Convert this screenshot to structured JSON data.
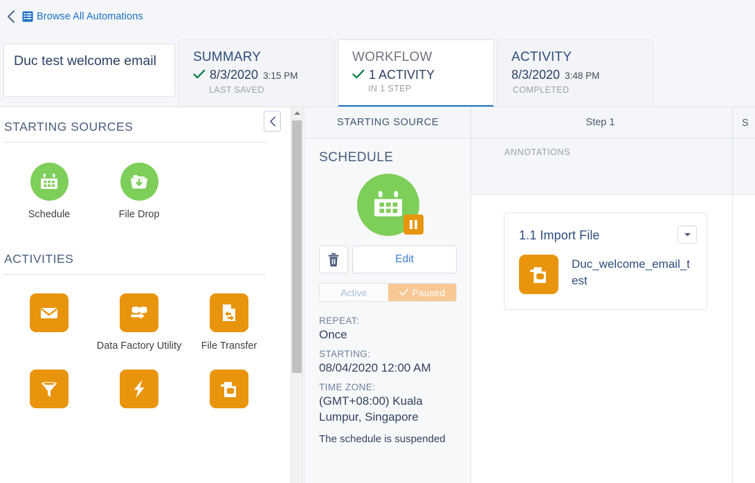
{
  "breadcrumb": {
    "back_icon": "chevron-left-icon",
    "list_icon": "list-table-icon",
    "link_label": "Browse All Automations"
  },
  "automation": {
    "name": "Duc test welcome email"
  },
  "tabs": [
    {
      "id": "summary",
      "title": "SUMMARY",
      "has_check": true,
      "date": "8/3/2020",
      "time": "3:15 PM",
      "subtitle": "LAST SAVED",
      "active": false,
      "title_color": "#2d4d7c"
    },
    {
      "id": "workflow",
      "title": "WORKFLOW",
      "has_check": true,
      "date": "1 ACTIVITY",
      "time": "",
      "subtitle": "IN 1 STEP",
      "active": true,
      "title_color": "#6d7580"
    },
    {
      "id": "activity",
      "title": "ACTIVITY",
      "has_check": false,
      "date": "8/3/2020",
      "time": "3:48 PM",
      "subtitle": "COMPLETED",
      "active": false,
      "title_color": "#2d4d7c"
    }
  ],
  "palette": {
    "starting_sources_heading": "STARTING SOURCES",
    "collapse_icon": "chevron-left-icon",
    "starting_sources": [
      {
        "label": "Schedule",
        "icon": "calendar-icon",
        "color": "#7ece5a"
      },
      {
        "label": "File Drop",
        "icon": "file-drop-icon",
        "color": "#7ece5a"
      }
    ],
    "activities_heading": "ACTIVITIES",
    "activities": [
      {
        "label": "",
        "icon": "envelope-icon",
        "color": "#e8940c"
      },
      {
        "label": "Data Factory Utility",
        "icon": "data-factory-icon",
        "color": "#e8940c"
      },
      {
        "label": "File Transfer",
        "icon": "file-transfer-icon",
        "color": "#e8940c"
      },
      {
        "label": "",
        "icon": "filter-icon",
        "color": "#e8940c"
      },
      {
        "label": "",
        "icon": "lightning-icon",
        "color": "#e8940c"
      },
      {
        "label": "",
        "icon": "import-file-icon",
        "color": "#e8940c"
      }
    ]
  },
  "starting_source": {
    "header": "STARTING SOURCE",
    "heading": "SCHEDULE",
    "icon": "calendar-icon",
    "badge_icon": "pause-icon",
    "delete_icon": "trash-icon",
    "edit_label": "Edit",
    "toggle": {
      "active_label": "Active",
      "paused_label": "Paused",
      "selected": "Paused",
      "paused_color": "#f7c894"
    },
    "details": [
      {
        "label": "REPEAT:",
        "value": "Once"
      },
      {
        "label": "STARTING:",
        "value": "08/04/2020 12:00 AM"
      },
      {
        "label": "TIME ZONE:",
        "value": "(GMT+08:00) Kuala Lumpur, Singapore"
      }
    ],
    "note": "The schedule is suspended"
  },
  "canvas": {
    "step_label": "Step 1",
    "next_step_label": "S",
    "annotations_label": "ANNOTATIONS",
    "activity_card": {
      "title": "1.1 Import File",
      "name": "Duc_welcome_email_test",
      "icon": "import-file-icon",
      "menu_icon": "chevron-down-icon",
      "icon_color": "#e8940c"
    }
  },
  "scrollbar": {
    "up_arrow_icon": "caret-up-icon"
  }
}
